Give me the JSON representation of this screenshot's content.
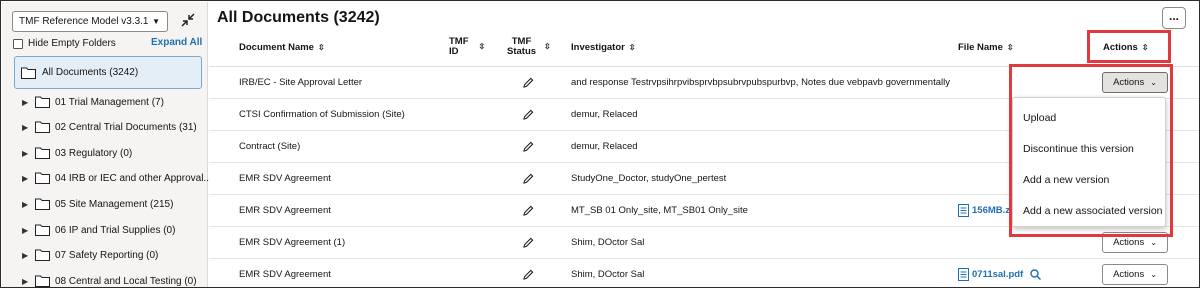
{
  "sidebar": {
    "model_select": "TMF Reference Model v3.3.1",
    "hide_empty_label": "Hide Empty Folders",
    "expand_all_label": "Expand All",
    "all_documents_label": "All Documents (3242)",
    "folders": [
      {
        "label": "01 Trial Management (7)"
      },
      {
        "label": "02 Central Trial Documents (31)"
      },
      {
        "label": "03 Regulatory (0)"
      },
      {
        "label": "04 IRB or IEC and other Approval..."
      },
      {
        "label": "05 Site Management (215)"
      },
      {
        "label": "06 IP and Trial Supplies (0)"
      },
      {
        "label": "07 Safety Reporting (0)"
      },
      {
        "label": "08 Central and Local Testing (0)"
      }
    ]
  },
  "main": {
    "title": "All Documents (3242)",
    "more_label": "...",
    "columns": {
      "document_name": "Document Name",
      "tmf_id_1": "TMF",
      "tmf_id_2": "ID",
      "tmf_status_1": "TMF",
      "tmf_status_2": "Status",
      "investigator": "Investigator",
      "file_name": "File Name",
      "actions": "Actions"
    },
    "rows": [
      {
        "document_name": "IRB/EC - Site Approval Letter",
        "investigator": "and response Testrvpsihrpvibsprvbpsubrvpubspurbvp, Notes due vebpavb governmentally",
        "file_name": "",
        "actions": "Actions"
      },
      {
        "document_name": "CTSI Confirmation of Submission (Site)",
        "investigator": "demur, Relaced",
        "file_name": "",
        "actions": ""
      },
      {
        "document_name": "Contract (Site)",
        "investigator": "demur, Relaced",
        "file_name": "",
        "actions": ""
      },
      {
        "document_name": "EMR SDV Agreement",
        "investigator": "StudyOne_Doctor, studyOne_pertest",
        "file_name": "",
        "actions": ""
      },
      {
        "document_name": "EMR SDV Agreement",
        "investigator": "MT_SB 01 Only_site, MT_SB01 Only_site",
        "file_name": "156MB.z",
        "actions": ""
      },
      {
        "document_name": "EMR SDV Agreement (1)",
        "investigator": "Shim, DOctor Sal",
        "file_name": "",
        "actions": "Actions"
      },
      {
        "document_name": "EMR SDV Agreement",
        "investigator": "Shim, DOctor Sal",
        "file_name": "0711sal.pdf",
        "actions": "Actions"
      }
    ],
    "actions_menu": [
      {
        "label": "Upload"
      },
      {
        "label": "Discontinue this version"
      },
      {
        "label": "Add a new version"
      },
      {
        "label": "Add a new associated version"
      }
    ]
  },
  "colors": {
    "highlight": "#e0393e",
    "link": "#1f6fb2",
    "selected_bg": "#e4eef7"
  }
}
